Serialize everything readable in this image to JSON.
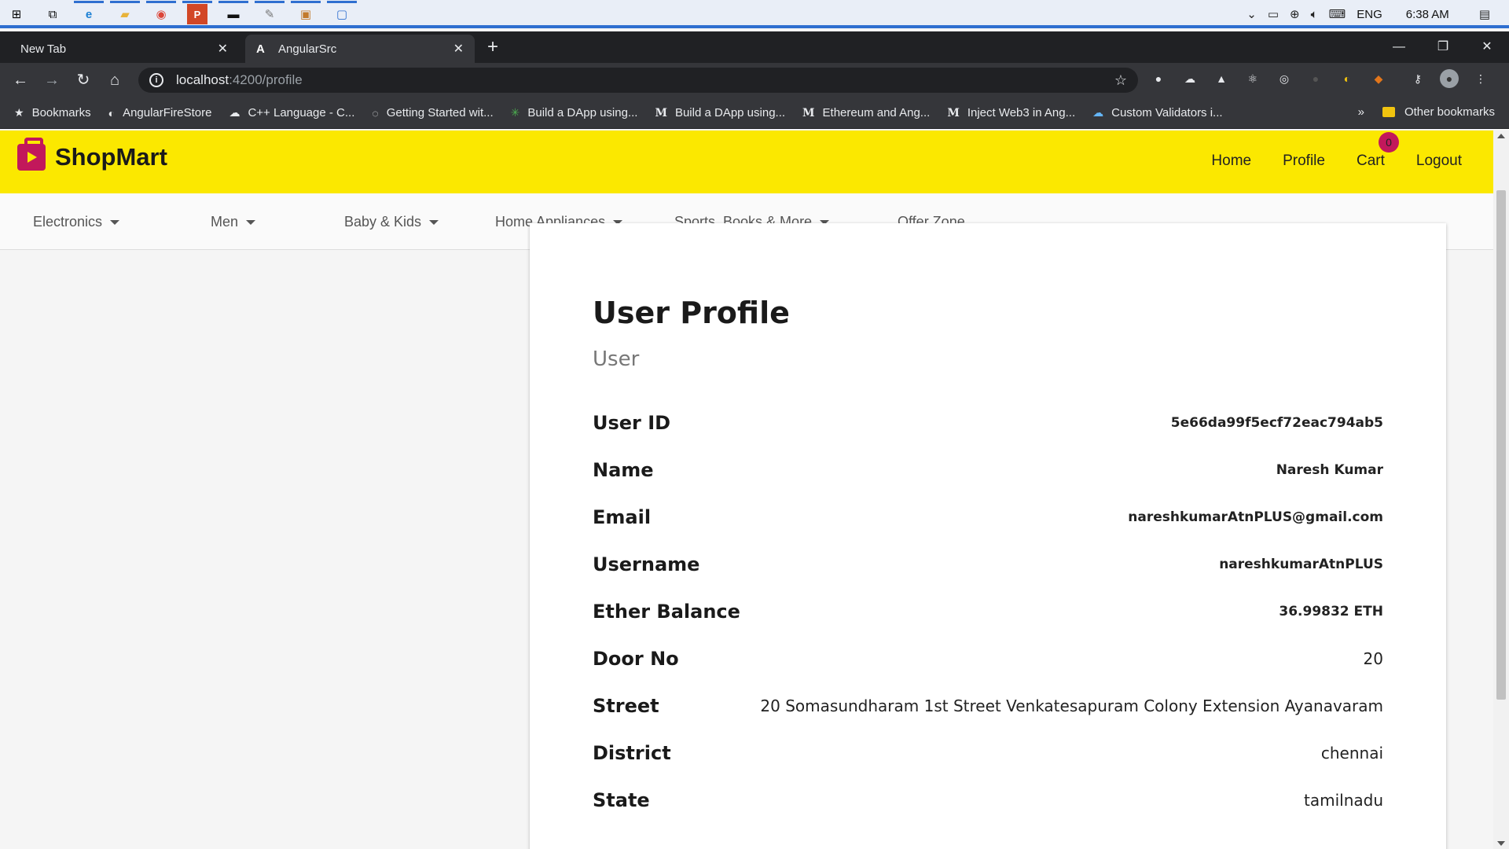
{
  "taskbar": {
    "apps": [
      {
        "name": "start-icon",
        "glyph": "⊞"
      },
      {
        "name": "task-view-icon",
        "glyph": "⧉"
      },
      {
        "name": "edge-icon",
        "glyph": "e"
      },
      {
        "name": "file-explorer-icon",
        "glyph": "▰"
      },
      {
        "name": "chrome-icon",
        "glyph": "◉"
      },
      {
        "name": "powerpoint-icon",
        "glyph": "P"
      },
      {
        "name": "terminal-icon",
        "glyph": "▬"
      },
      {
        "name": "paint-icon",
        "glyph": "✎"
      },
      {
        "name": "box-icon",
        "glyph": "▣"
      },
      {
        "name": "remote-desktop-icon",
        "glyph": "▢"
      }
    ],
    "language": "ENG",
    "time": "6:38 AM"
  },
  "browser": {
    "tabs": [
      {
        "title": "New Tab",
        "active": false
      },
      {
        "title": "AngularSrc",
        "active": true,
        "favicon": "A"
      }
    ],
    "url_host": "localhost",
    "url_path": ":4200/profile",
    "bookmarks": [
      {
        "label": "Bookmarks",
        "icon": "★"
      },
      {
        "label": "AngularFireStore",
        "icon": "◐"
      },
      {
        "label": "C++ Language - C...",
        "icon": "☁"
      },
      {
        "label": "Getting Started wit...",
        "icon": "◌"
      },
      {
        "label": "Build a DApp using...",
        "icon": "✳"
      },
      {
        "label": "Build a DApp using...",
        "icon": "M"
      },
      {
        "label": "Ethereum and Ang...",
        "icon": "M"
      },
      {
        "label": "Inject Web3 in Ang...",
        "icon": "M"
      },
      {
        "label": "Custom Validators i...",
        "icon": "☁"
      }
    ],
    "more_bookmarks": "»",
    "other_bookmarks": "Other bookmarks"
  },
  "header": {
    "brand": "ShopMart",
    "nav": {
      "home": "Home",
      "profile": "Profile",
      "cart": "Cart",
      "cart_count": "0",
      "logout": "Logout"
    },
    "colors": {
      "background": "#fbe800",
      "accent": "#c2185b"
    }
  },
  "categories": [
    "Electronics",
    "Men",
    "Baby & Kids",
    "Home Appliances",
    "Sports, Books & More",
    "Offer Zone"
  ],
  "profile": {
    "title": "User Profile",
    "subtitle": "User",
    "user_id_label": "User ID",
    "user_id": "5e66da99f5ecf72eac794ab5",
    "name_label": "Name",
    "name": "Naresh Kumar",
    "email_label": "Email",
    "email": "nareshkumarAtnPLUS@gmail.com",
    "username_label": "Username",
    "username": "nareshkumarAtnPLUS",
    "ether_label": "Ether Balance",
    "ether": "36.99832 ETH",
    "door_label": "Door No",
    "door": "20",
    "street_label": "Street",
    "street": "20 Somasundharam 1st Street Venkatesapuram Colony Extension Ayanavaram",
    "district_label": "District",
    "district": "chennai",
    "state_label": "State",
    "state": "tamilnadu"
  }
}
